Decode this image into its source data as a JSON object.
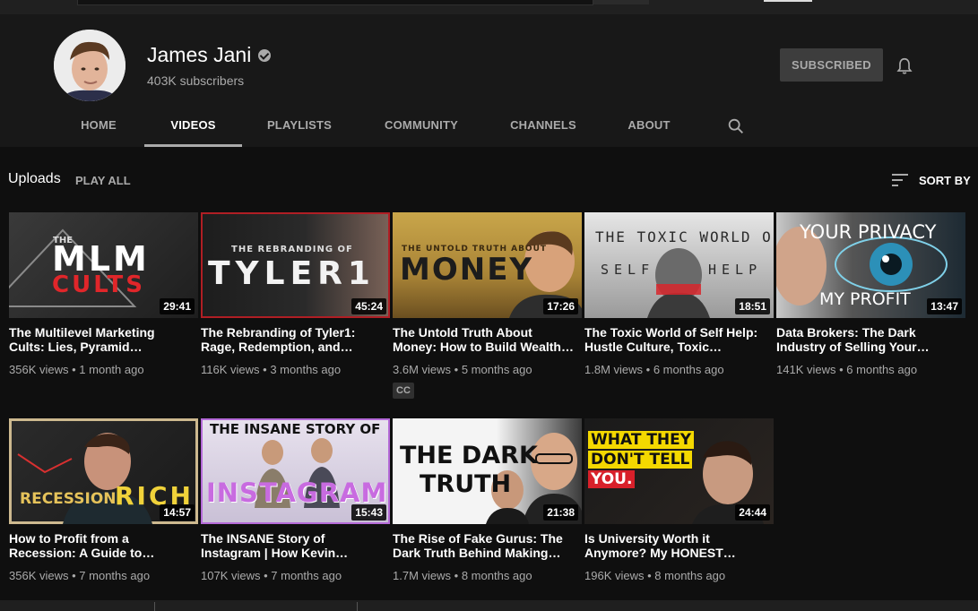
{
  "channel": {
    "name": "James Jani",
    "subscribers": "403K subscribers",
    "subscribe_label": "SUBSCRIBED"
  },
  "tabs": [
    {
      "label": "HOME"
    },
    {
      "label": "VIDEOS"
    },
    {
      "label": "PLAYLISTS"
    },
    {
      "label": "COMMUNITY"
    },
    {
      "label": "CHANNELS"
    },
    {
      "label": "ABOUT"
    }
  ],
  "active_tab": "VIDEOS",
  "section": {
    "title": "Uploads",
    "play_all": "PLAY ALL",
    "sort_by": "SORT BY"
  },
  "videos": [
    {
      "title": "The Multilevel Marketing Cults: Lies, Pyramid…",
      "views": "356K views",
      "age": "1 month ago",
      "duration": "29:41",
      "thumb_text": [
        "THE",
        "MLM",
        "CULTS"
      ]
    },
    {
      "title": "The Rebranding of Tyler1: Rage, Redemption, and…",
      "views": "116K views",
      "age": "3 months ago",
      "duration": "45:24",
      "thumb_text": [
        "THE REBRANDING OF",
        "TYLER1"
      ]
    },
    {
      "title": "The Untold Truth About Money: How to Build Wealth…",
      "views": "3.6M views",
      "age": "5 months ago",
      "duration": "17:26",
      "badge": "CC",
      "thumb_text": [
        "THE UNTOLD TRUTH ABOUT",
        "MONEY"
      ]
    },
    {
      "title": "The Toxic World of Self Help: Hustle Culture, Toxic…",
      "views": "1.8M views",
      "age": "6 months ago",
      "duration": "18:51",
      "thumb_text": [
        "THE TOXIC WORLD OF",
        "SELF",
        "HELP"
      ]
    },
    {
      "title": "Data Brokers: The Dark Industry of Selling Your…",
      "views": "141K views",
      "age": "6 months ago",
      "duration": "13:47",
      "thumb_text": [
        "YOUR PRIVACY",
        "MY PROFIT"
      ]
    },
    {
      "title": "How to Profit from a Recession: A Guide to…",
      "views": "356K views",
      "age": "7 months ago",
      "duration": "14:57",
      "thumb_text": [
        "RECESSION",
        "RICH"
      ]
    },
    {
      "title": "The INSANE Story of Instagram | How Kevin…",
      "views": "107K views",
      "age": "7 months ago",
      "duration": "15:43",
      "thumb_text": [
        "THE INSANE STORY OF",
        "INSTAGRAM"
      ]
    },
    {
      "title": "The Rise of Fake Gurus: The Dark Truth Behind Making…",
      "views": "1.7M views",
      "age": "8 months ago",
      "duration": "21:38",
      "thumb_text": [
        "THE DARK",
        "TRUTH"
      ]
    },
    {
      "title": "Is University Worth it Anymore? My HONEST…",
      "views": "196K views",
      "age": "8 months ago",
      "duration": "24:44",
      "thumb_text": [
        "WHAT THEY",
        "DON'T TELL",
        "YOU."
      ]
    }
  ],
  "meta_separator": "•",
  "icons": {
    "verified": "verified-check-icon",
    "bell": "bell-icon",
    "search": "search-icon",
    "sort": "sort-icon"
  },
  "colors": {
    "background": "#181818",
    "content_background": "#0f0f0f",
    "text_secondary": "#aaaaaa",
    "subscribed_button": "#3d3d3d"
  }
}
